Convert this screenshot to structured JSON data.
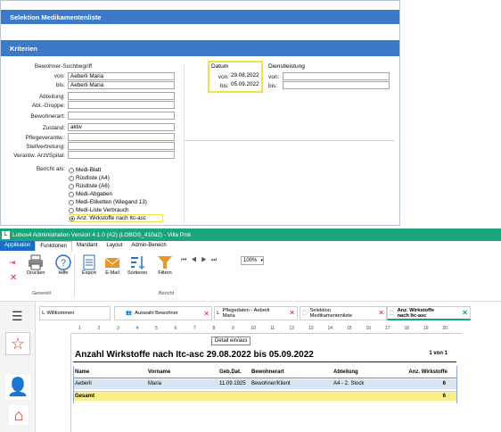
{
  "dialog": {
    "title": "Selektion Medikamentenliste",
    "criteria_header": "Kriterien",
    "bewohner_label": "Bewohner-Suchbegriff",
    "von_label": "von:",
    "von_value": "Aeberli Maria",
    "bis_label": "bis:",
    "bis_value": "Aeberli Maria",
    "abteilung_label": "Abteilung:",
    "gruppe_label": "Abt.-Gruppe:",
    "bewohnerart_label": "Bewohnerart:",
    "zustand_label": "Zustand:",
    "zustand_value": "aktiv",
    "pflege_label": "Pflegeverantw.:",
    "stell_label": "Stellvertretung:",
    "arzt_label": "Verantw. Arzt/Spital:",
    "bericht_label": "Bericht als:",
    "radios": [
      "Medi-Blatt",
      "Rüstliste (A4)",
      "Rüstliste (A6)",
      "Medi-Abgaben",
      "Medi-Etiketten (Wiegand 13)",
      "Medi-Liste Verbrauch",
      "Anz. Wirkstoffe nach Itc-asc"
    ],
    "datum_label": "Datum",
    "datum_von_label": "von:",
    "datum_von_value": "29.08.2022",
    "datum_bis_label": "bis:",
    "datum_bis_value": "05.09.2022",
    "dienst_label": "Dienstleistung",
    "dienst_von_label": "von:",
    "dienst_bis_label": "bis:"
  },
  "app": {
    "title": "Lobos4 Administration Version 4.1.0 (A2) (LOBOS_410a2) - Villa Pink",
    "menu": [
      "Applikation",
      "Funktionen",
      "Mandant",
      "Layout",
      "Admin-Bereich"
    ],
    "buttons": {
      "drucken": "Drucken",
      "hilfe": "Hilfe",
      "export": "Export",
      "email": "E-Mail",
      "sortieren": "Sortieren",
      "filtern": "Filtern"
    },
    "zoom": "100%",
    "group_generell": "Generell",
    "group_bericht": "Bericht",
    "tabs": [
      {
        "label": "Willkommen"
      },
      {
        "label": "Auswahl Bewohner"
      },
      {
        "label": "Pflegedaten - Aeberli Maria"
      },
      {
        "label": "Selektion Medikamentenliste"
      },
      {
        "label": "Anz. Wirkstoffe nach Itc-asc"
      }
    ],
    "tooltip": "Detail ein/aus",
    "ruler_marks": [
      "1",
      "2",
      "3",
      "4",
      "5",
      "6",
      "7",
      "8",
      "9",
      "10",
      "11",
      "12",
      "13",
      "14",
      "15",
      "16",
      "17",
      "18",
      "19",
      "20"
    ],
    "report": {
      "title": "Anzahl Wirkstoffe nach Itc-asc 29.08.2022 bis 05.09.2022",
      "page": "1 von 1",
      "headers": [
        "Name",
        "Vorname",
        "Geb.Dat.",
        "Bewohnerart",
        "Abteilung",
        "Anz. Wirkstoffe"
      ],
      "row": [
        "Aeberli",
        "Maria",
        "11.09.1925",
        "Bewohner/Klient",
        "A4 - 2. Stock",
        "6"
      ],
      "total_label": "Gesamt",
      "total_value": "6"
    }
  }
}
